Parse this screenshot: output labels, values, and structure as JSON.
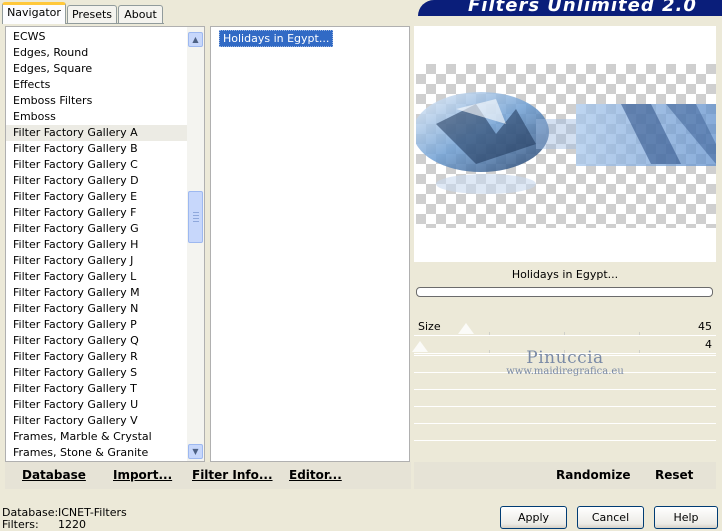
{
  "tabs": [
    {
      "label": "Navigator",
      "active": true
    },
    {
      "label": "Presets",
      "active": false
    },
    {
      "label": "About",
      "active": false
    }
  ],
  "banner": {
    "title": "Filters Unlimited 2.0"
  },
  "categories": [
    "ECWS",
    "Edges, Round",
    "Edges, Square",
    "Effects",
    "Emboss Filters",
    "Emboss",
    "Filter Factory Gallery A",
    "Filter Factory Gallery B",
    "Filter Factory Gallery C",
    "Filter Factory Gallery D",
    "Filter Factory Gallery E",
    "Filter Factory Gallery F",
    "Filter Factory Gallery G",
    "Filter Factory Gallery H",
    "Filter Factory Gallery J",
    "Filter Factory Gallery L",
    "Filter Factory Gallery M",
    "Filter Factory Gallery N",
    "Filter Factory Gallery P",
    "Filter Factory Gallery Q",
    "Filter Factory Gallery R",
    "Filter Factory Gallery S",
    "Filter Factory Gallery T",
    "Filter Factory Gallery U",
    "Filter Factory Gallery V",
    "Frames, Marble & Crystal",
    "Frames, Stone & Granite"
  ],
  "selected_category": "Filter Factory Gallery A",
  "filters": {
    "selected": "Holidays in Egypt..."
  },
  "preview": {
    "filter_name": "Holidays in Egypt..."
  },
  "sliders": [
    {
      "label": "Size",
      "value": "45"
    },
    {
      "label": "",
      "value": "4"
    }
  ],
  "watermark": {
    "line1": "Pinuccia",
    "line2": "www.maidiregrafica.eu"
  },
  "buttons": {
    "database": "Database",
    "import": "Import...",
    "filter_info": "Filter Info...",
    "editor": "Editor...",
    "randomize": "Randomize",
    "reset": "Reset",
    "apply": "Apply",
    "cancel": "Cancel",
    "help": "Help"
  },
  "status": {
    "database_label": "Database:",
    "database_value": "ICNET-Filters",
    "filters_label": "Filters:",
    "filters_value": "1220"
  },
  "icons": {
    "scroll_up": "scroll-up-arrow-icon",
    "scroll_down": "scroll-down-arrow-icon"
  },
  "colors": {
    "selection": "#316ac5",
    "banner": "#0a1e7a",
    "tab_highlight": "#ffc83c"
  }
}
